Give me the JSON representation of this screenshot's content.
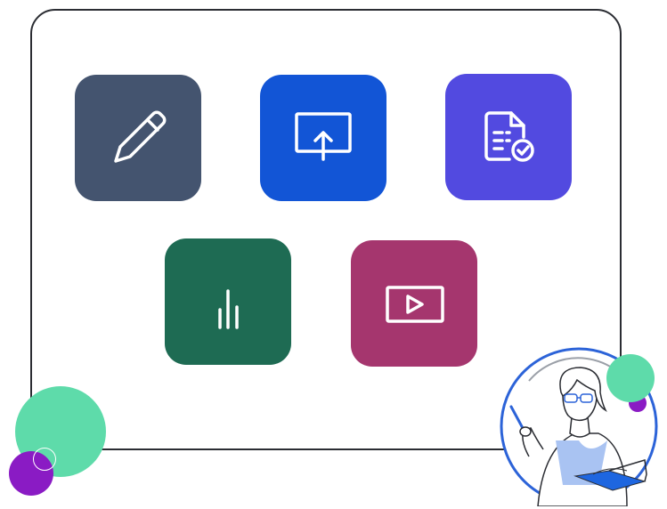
{
  "tiles": [
    {
      "id": "edit",
      "icon": "pencil-icon",
      "color": "#44546f"
    },
    {
      "id": "present",
      "icon": "screen-upload-icon",
      "color": "#1255d6"
    },
    {
      "id": "approve",
      "icon": "document-check-icon",
      "color": "#524ae0"
    },
    {
      "id": "analytics",
      "icon": "bar-chart-icon",
      "color": "#1e6b53"
    },
    {
      "id": "video",
      "icon": "play-video-icon",
      "color": "#a5366e"
    }
  ],
  "decor": {
    "mint": "#5edbaa",
    "purple": "#8a1bc4",
    "ring_blue": "#2c63d8",
    "panel_border": "#2b2d33"
  }
}
